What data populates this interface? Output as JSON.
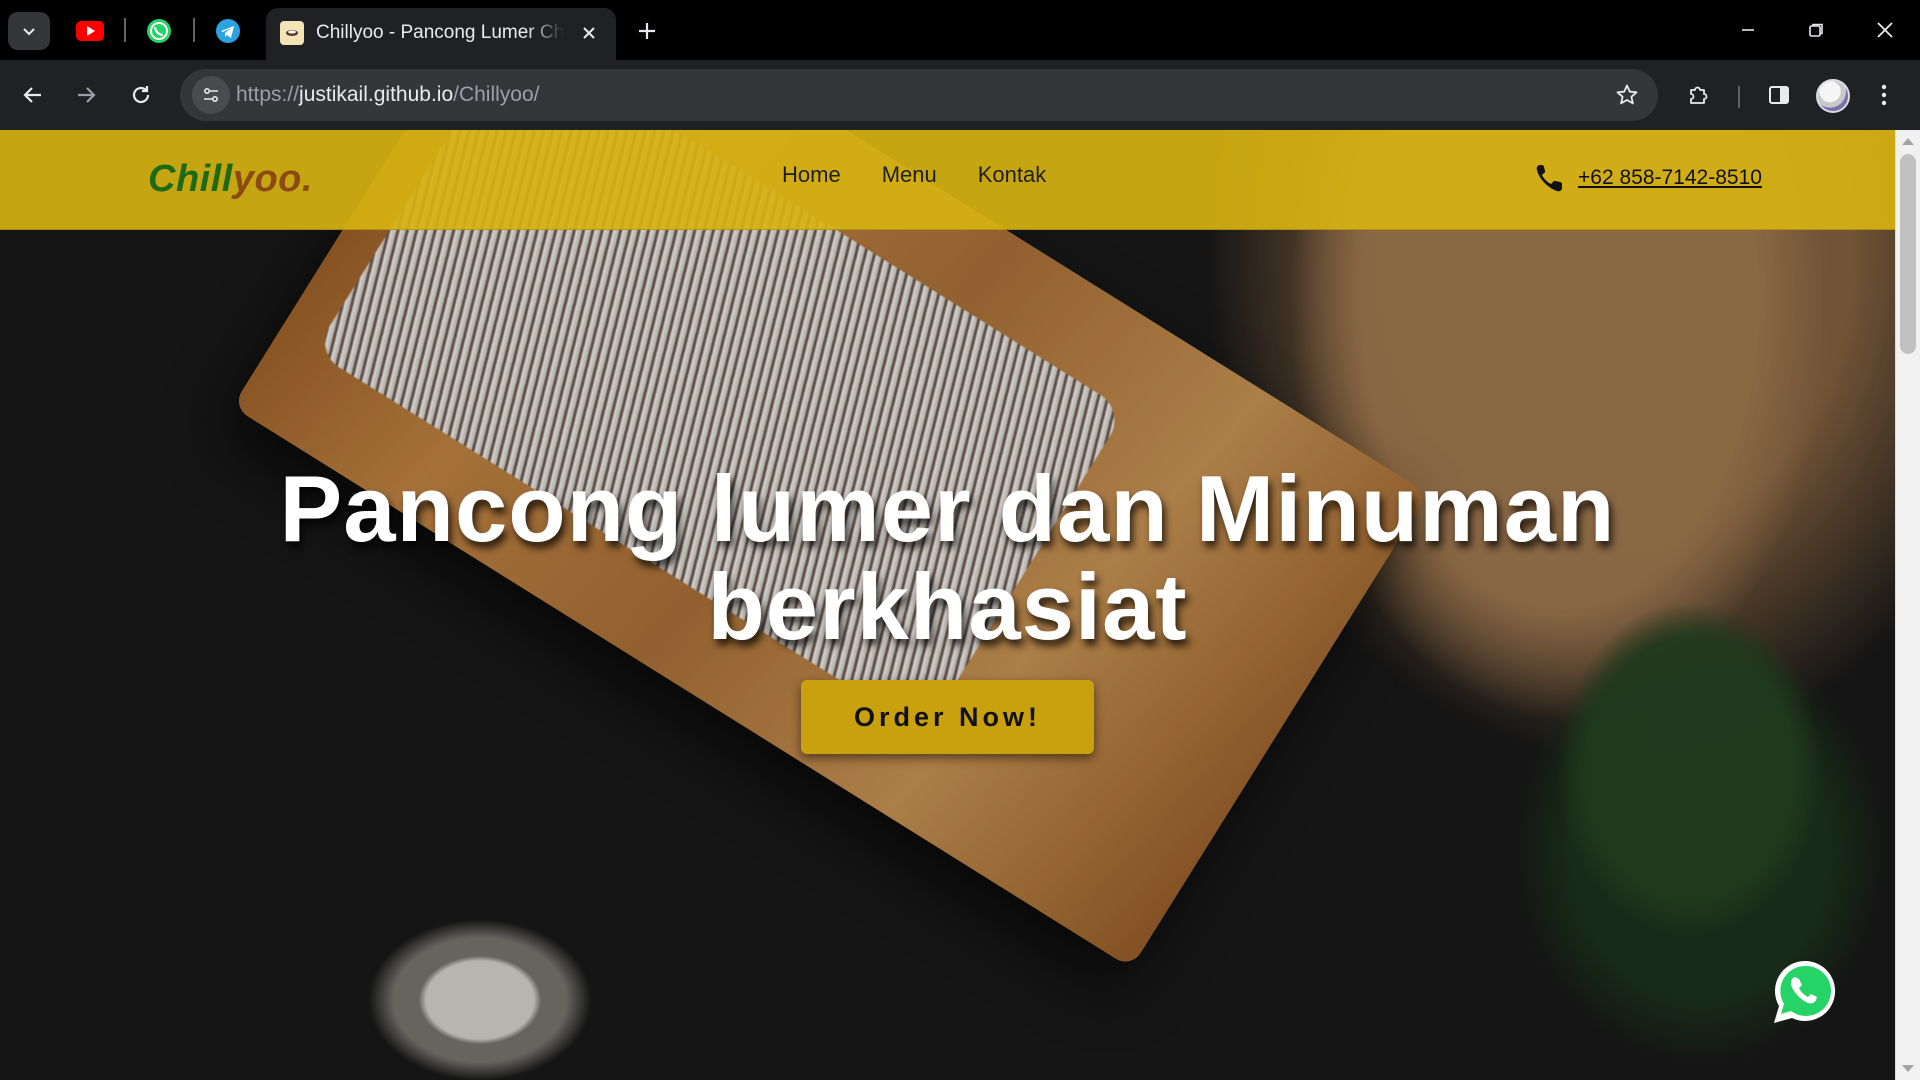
{
  "browser": {
    "pinned_tabs": [
      {
        "name": "youtube-tab",
        "icon": "youtube-icon",
        "color": "#ff0000"
      },
      {
        "name": "whatsapp-tab",
        "icon": "whatsapp-icon",
        "color": "#25d366"
      },
      {
        "name": "telegram-tab",
        "icon": "telegram-icon",
        "color": "#2aa3e0"
      }
    ],
    "active_tab": {
      "title": "Chillyoo - Pancong Lumer Chillyoo",
      "icon": "site-favicon"
    },
    "address": {
      "scheme": "https://",
      "host": "justikail.github.io",
      "path": "/Chillyoo/"
    }
  },
  "site": {
    "logo": {
      "part1": "Chill",
      "part2": "yoo."
    },
    "nav": [
      {
        "label": "Home"
      },
      {
        "label": "Menu"
      },
      {
        "label": "Kontak"
      }
    ],
    "phone": "+62 858-7142-8510",
    "hero": {
      "title_line1": "Pancong lumer dan Minuman",
      "title_line2": "berkhasiat",
      "cta": "Order Now!"
    }
  },
  "colors": {
    "header_bg": "#d6b212",
    "logo_green": "#1c6a14",
    "logo_brown": "#8a4a10",
    "cta_bg": "#c9a10e",
    "browser_dark": "#202124"
  }
}
